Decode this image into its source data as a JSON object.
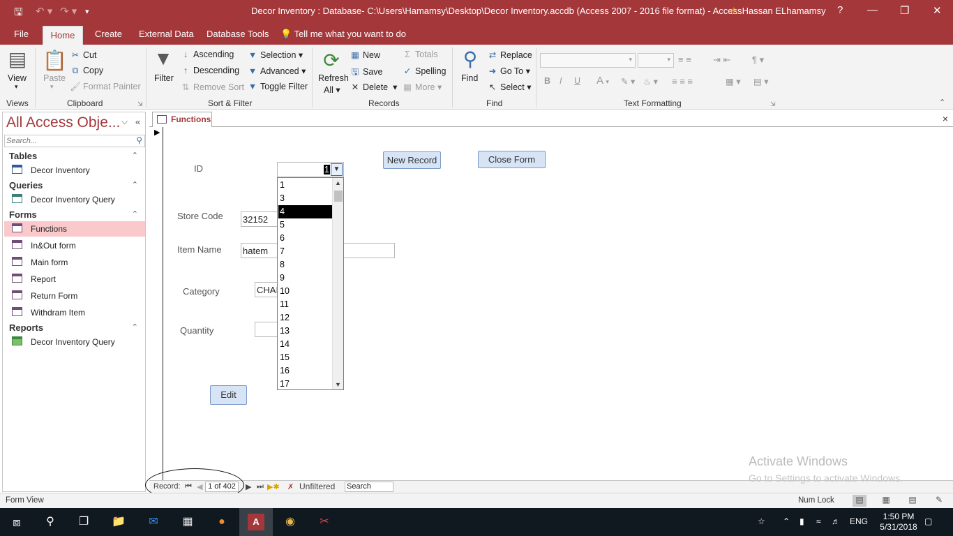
{
  "window": {
    "title": "Decor Inventory : Database- C:\\Users\\Hamamsy\\Desktop\\Decor Inventory.accdb (Access 2007 - 2016 file format)  -  Access",
    "user": "Hassan ELhamamsy",
    "help": "?"
  },
  "ribbon_tabs": [
    "File",
    "Home",
    "Create",
    "External Data",
    "Database Tools"
  ],
  "tell_me": "Tell me what you want to do",
  "ribbon": {
    "views": {
      "view_label": "View",
      "group": "Views"
    },
    "clipboard": {
      "paste": "Paste",
      "cut": "Cut",
      "copy": "Copy",
      "format_painter": "Format Painter",
      "group": "Clipboard"
    },
    "sort_filter": {
      "filter": "Filter",
      "ascending": "Ascending",
      "descending": "Descending",
      "remove_sort": "Remove Sort",
      "selection": "Selection",
      "advanced": "Advanced",
      "toggle_filter": "Toggle Filter",
      "group": "Sort & Filter"
    },
    "records": {
      "refresh": "Refresh",
      "refresh_all": "All",
      "new": "New",
      "save": "Save",
      "delete": "Delete",
      "totals": "Totals",
      "spelling": "Spelling",
      "more": "More",
      "group": "Records"
    },
    "find": {
      "find": "Find",
      "replace": "Replace",
      "goto": "Go To",
      "select": "Select",
      "group": "Find"
    },
    "text_formatting": {
      "bold": "B",
      "italic": "I",
      "underline": "U",
      "font_color": "A",
      "group": "Text Formatting"
    }
  },
  "nav": {
    "title": "All Access Obje...",
    "search_placeholder": "Search...",
    "groups": [
      {
        "label": "Tables",
        "items": [
          "Decor Inventory"
        ]
      },
      {
        "label": "Queries",
        "items": [
          "Decor Inventory Query"
        ]
      },
      {
        "label": "Forms",
        "items": [
          "Functions",
          "In&Out form",
          "Main form",
          "Report",
          "Return Form",
          "Withdram Item"
        ]
      },
      {
        "label": "Reports",
        "items": [
          "Decor Inventory Query"
        ]
      }
    ],
    "selected_item": "Functions"
  },
  "document": {
    "tab_label": "Functions",
    "close": "×"
  },
  "form": {
    "id_label": "ID",
    "id_value": "1",
    "store_code_label": "Store Code",
    "store_code_value": "32152",
    "item_name_label": "Item Name",
    "item_name_value": "hatem",
    "category_label": "Category",
    "category_value": "CHAI",
    "quantity_label": "Quantity",
    "quantity_value": "",
    "new_record": "New Record",
    "close_form": "Close Form",
    "edit": "Edit"
  },
  "id_dropdown": {
    "options": [
      "1",
      "3",
      "4",
      "5",
      "6",
      "7",
      "8",
      "9",
      "10",
      "11",
      "12",
      "13",
      "14",
      "15",
      "16",
      "17"
    ],
    "highlighted": "4"
  },
  "record_nav": {
    "label": "Record:",
    "position": "1 of 402",
    "filter_status": "Unfiltered",
    "search": "Search"
  },
  "watermark": {
    "line1": "Activate Windows",
    "line2": "Go to Settings to activate Windows."
  },
  "status": {
    "view": "Form View",
    "num_lock": "Num Lock"
  },
  "taskbar": {
    "language": "ENG",
    "time": "1:50 PM",
    "date": "5/31/2018"
  }
}
